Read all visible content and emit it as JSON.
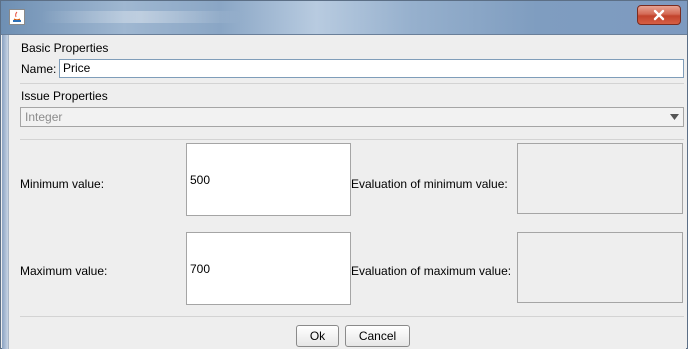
{
  "window": {
    "close_label": "X"
  },
  "basic_properties": {
    "title": "Basic Properties",
    "name_label": "Name:",
    "name_value": "Price"
  },
  "issue_properties": {
    "title": "Issue Properties",
    "type_selected": "Integer"
  },
  "minimum": {
    "label": "Minimum value:",
    "value": "500",
    "evaluation_label": "Evaluation of minimum value:"
  },
  "maximum": {
    "label": "Maximum value:",
    "value": "700",
    "evaluation_label": "Evaluation of maximum value:"
  },
  "buttons": {
    "ok": "Ok",
    "cancel": "Cancel"
  },
  "colors": {
    "close_button": "#c2432c",
    "field_border": "#7f9db9",
    "panel_bg": "#eeeeee"
  }
}
